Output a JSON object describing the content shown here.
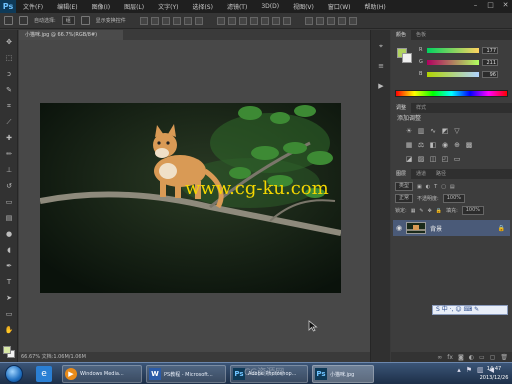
{
  "app": {
    "logo": "Ps"
  },
  "menu": [
    "文件(F)",
    "编辑(E)",
    "图像(I)",
    "图层(L)",
    "文字(Y)",
    "选择(S)",
    "滤镜(T)",
    "3D(D)",
    "视图(V)",
    "窗口(W)",
    "帮助(H)"
  ],
  "options": {
    "auto_select": "自动选择:",
    "auto_select_value": "组",
    "show_transform": "显示变换控件"
  },
  "document": {
    "tab_title": "小猫咪.jpg @ 66.7%(RGB/8#)",
    "watermark": "www.cg-ku.com",
    "status": "66.67%   文档:1.06M/1.06M"
  },
  "panels": {
    "color_tabs": [
      "颜色",
      "色板"
    ],
    "color": {
      "rows": [
        {
          "label": "R",
          "value": "177"
        },
        {
          "label": "G",
          "value": "211"
        },
        {
          "label": "B",
          "value": "96"
        }
      ]
    },
    "adjust_tabs": [
      "调整",
      "样式"
    ],
    "adjust_title": "添加调整",
    "layer_tabs": [
      "图层",
      "通道",
      "路径"
    ],
    "layer_kind": "类型",
    "blend_mode": "正常",
    "opacity_label": "不透明度:",
    "opacity_value": "100%",
    "lock_label": "锁定:",
    "fill_label": "填充:",
    "fill_value": "100%",
    "layer_name": "背景",
    "ime": "S 中 ·, ☺ ⌨ ✎"
  },
  "taskbar": {
    "buttons": [
      {
        "icon": "▶",
        "label": "Windows Media..."
      },
      {
        "icon": "W",
        "label": "PS教程 - Microsoft..."
      },
      {
        "icon": "Ps",
        "label": "Adobe Photoshop..."
      },
      {
        "icon": "Ps",
        "label": "小猫咪.jpg"
      }
    ],
    "clock_time": "14:47",
    "clock_date": "2013/12/26",
    "watermark": "CG资源网"
  },
  "colors": {
    "accent": "#4a5a78",
    "ps_blue": "#0e3a58",
    "foreground_swatch": "#d9e8a6",
    "watermark_text": "#f4d600"
  }
}
